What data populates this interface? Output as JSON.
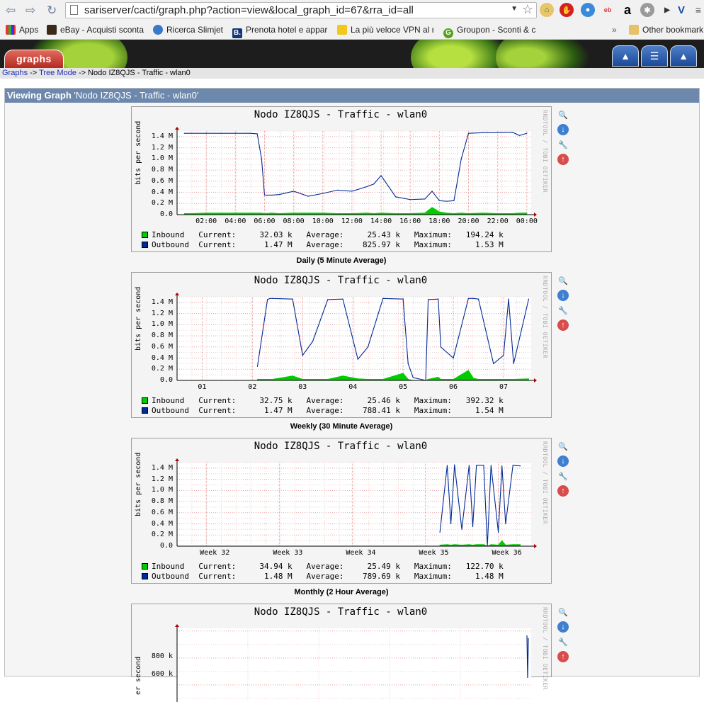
{
  "browser": {
    "url_host": "sariserver",
    "url_path": "/cacti/graph.php?action=view&local_graph_id=67&rra_id=all",
    "bookmarks": [
      "Apps",
      "eBay - Acquisti sconta",
      "Ricerca Slimjet",
      "Prenota hotel e appar",
      "La più veloce VPN al n",
      "Groupon - Sconti & c"
    ],
    "other_bookmarks": "Other bookmark"
  },
  "header": {
    "tab_label": "graphs"
  },
  "breadcrumb": {
    "graphs": "Graphs",
    "sep1": " -> ",
    "tree_mode": "Tree Mode",
    "sep2": " -> ",
    "current": "Nodo IZ8QJS - Traffic - wlan0"
  },
  "view": {
    "label": "Viewing Graph",
    "name": "'Nodo IZ8QJS - Traffic - wlan0'"
  },
  "colors": {
    "inbound": "#00cc00",
    "outbound": "#002a97",
    "grid": "#e8a0a0"
  },
  "graphs": [
    {
      "title": "Nodo IZ8QJS - Traffic - wlan0",
      "vlabel": "bits per second",
      "rrdtool": "RRDTOOL / TOBI OETIKER",
      "caption": "Daily (5 Minute Average)",
      "yticks": [
        "1.4 M",
        "1.2 M",
        "1.0 M",
        "0.8 M",
        "0.6 M",
        "0.4 M",
        "0.2 M",
        "0.0"
      ],
      "xticks": [
        "02:00",
        "04:00",
        "06:00",
        "08:00",
        "10:00",
        "12:00",
        "14:00",
        "16:00",
        "18:00",
        "20:00",
        "22:00",
        "00:00"
      ],
      "legend": [
        {
          "name": "Inbound ",
          "text": "  Current:     32.03 k   Average:     25.43 k   Maximum:   194.24 k"
        },
        {
          "name": "Outbound",
          "text": "  Current:      1.47 M   Average:    825.97 k   Maximum:     1.53 M"
        }
      ]
    },
    {
      "title": "Nodo IZ8QJS - Traffic - wlan0",
      "vlabel": "bits per second",
      "rrdtool": "RRDTOOL / TOBI OETIKER",
      "caption": "Weekly (30 Minute Average)",
      "yticks": [
        "1.4 M",
        "1.2 M",
        "1.0 M",
        "0.8 M",
        "0.6 M",
        "0.4 M",
        "0.2 M",
        "0.0"
      ],
      "xticks": [
        "01",
        "02",
        "03",
        "04",
        "05",
        "06",
        "07"
      ],
      "legend": [
        {
          "name": "Inbound ",
          "text": "  Current:     32.75 k   Average:     25.46 k   Maximum:   392.32 k"
        },
        {
          "name": "Outbound",
          "text": "  Current:      1.47 M   Average:    788.41 k   Maximum:     1.54 M"
        }
      ]
    },
    {
      "title": "Nodo IZ8QJS - Traffic - wlan0",
      "vlabel": "bits per second",
      "rrdtool": "RRDTOOL / TOBI OETIKER",
      "caption": "Monthly (2 Hour Average)",
      "yticks": [
        "1.4 M",
        "1.2 M",
        "1.0 M",
        "0.8 M",
        "0.6 M",
        "0.4 M",
        "0.2 M",
        "0.0"
      ],
      "xticks": [
        "Week 32",
        "Week 33",
        "Week 34",
        "Week 35",
        "Week 36"
      ],
      "legend": [
        {
          "name": "Inbound ",
          "text": "  Current:     34.94 k   Average:     25.49 k   Maximum:   122.70 k"
        },
        {
          "name": "Outbound",
          "text": "  Current:      1.48 M   Average:    789.69 k   Maximum:     1.48 M"
        }
      ]
    },
    {
      "title": "Nodo IZ8QJS - Traffic - wlan0",
      "vlabel": "er second",
      "rrdtool": "RRDTOOL / TOBI OETIKER",
      "caption": "",
      "yticks": [
        "800 k",
        "600 k"
      ],
      "xticks": [],
      "legend": []
    }
  ],
  "chart_data": [
    {
      "type": "line",
      "title": "Nodo IZ8QJS - Traffic - wlan0",
      "ylabel": "bits per second",
      "ylim": [
        0,
        1.5
      ],
      "x_unit": "hour of day",
      "x": [
        0.5,
        1,
        2,
        3,
        4,
        5,
        5.5,
        5.8,
        6,
        6.5,
        7,
        8,
        9,
        10,
        11,
        12,
        13,
        13.5,
        14,
        15,
        16,
        17,
        17.5,
        18,
        18.5,
        19,
        19.5,
        20,
        21,
        22,
        23,
        23.5,
        24
      ],
      "series": [
        {
          "name": "Outbound",
          "values": [
            1.46,
            1.46,
            1.46,
            1.46,
            1.46,
            1.46,
            1.45,
            1.0,
            0.35,
            0.35,
            0.36,
            0.42,
            0.33,
            0.38,
            0.44,
            0.42,
            0.5,
            0.55,
            0.7,
            0.32,
            0.27,
            0.28,
            0.42,
            0.25,
            0.24,
            0.25,
            1.0,
            1.46,
            1.47,
            1.47,
            1.48,
            1.42,
            1.46
          ]
        },
        {
          "name": "Inbound",
          "values": [
            0.02,
            0.02,
            0.03,
            0.03,
            0.03,
            0.03,
            0.03,
            0.03,
            0.02,
            0.03,
            0.02,
            0.03,
            0.03,
            0.03,
            0.02,
            0.02,
            0.03,
            0.02,
            0.03,
            0.02,
            0.02,
            0.03,
            0.13,
            0.05,
            0.03,
            0.02,
            0.03,
            0.02,
            0.03,
            0.02,
            0.02,
            0.03,
            0.03
          ]
        }
      ]
    },
    {
      "type": "line",
      "title": "Nodo IZ8QJS - Traffic - wlan0",
      "ylabel": "bits per second",
      "ylim": [
        0,
        1.5
      ],
      "x_unit": "day of month",
      "x": [
        2.1,
        2.3,
        2.35,
        2.4,
        2.8,
        3.0,
        3.2,
        3.5,
        3.8,
        4.1,
        4.3,
        4.6,
        5.0,
        5.1,
        5.2,
        5.45,
        5.5,
        5.7,
        5.75,
        6.0,
        6.3,
        6.4,
        6.5,
        6.8,
        7.0,
        7.1,
        7.2,
        7.5
      ],
      "series": [
        {
          "name": "Outbound",
          "values": [
            0.25,
            1.45,
            1.47,
            1.47,
            1.46,
            0.45,
            0.7,
            1.45,
            1.46,
            0.38,
            0.6,
            1.47,
            1.46,
            0.3,
            0.05,
            0.0,
            1.45,
            1.46,
            0.6,
            0.4,
            1.47,
            1.47,
            1.46,
            0.3,
            0.45,
            1.46,
            0.3,
            1.46
          ]
        },
        {
          "name": "Inbound",
          "values": [
            0.02,
            0.02,
            0.02,
            0.02,
            0.08,
            0.02,
            0.02,
            0.02,
            0.08,
            0.03,
            0.02,
            0.02,
            0.13,
            0.02,
            0.0,
            0.0,
            0.02,
            0.06,
            0.02,
            0.02,
            0.18,
            0.04,
            0.02,
            0.02,
            0.02,
            0.02,
            0.02,
            0.03
          ]
        }
      ]
    },
    {
      "type": "line",
      "title": "Nodo IZ8QJS - Traffic - wlan0",
      "ylabel": "bits per second",
      "ylim": [
        0,
        1.5
      ],
      "x_unit": "ISO week",
      "x": [
        35.2,
        35.3,
        35.35,
        35.4,
        35.5,
        35.6,
        35.65,
        35.7,
        35.8,
        35.85,
        35.9,
        36.0,
        36.05,
        36.1,
        36.2,
        36.3
      ],
      "series": [
        {
          "name": "Outbound",
          "values": [
            0.25,
            1.45,
            0.4,
            1.46,
            0.3,
            1.45,
            0.35,
            1.45,
            1.45,
            0.0,
            1.45,
            0.25,
            1.44,
            0.4,
            1.45,
            1.44
          ]
        },
        {
          "name": "Inbound",
          "values": [
            0.02,
            0.03,
            0.02,
            0.03,
            0.02,
            0.03,
            0.02,
            0.03,
            0.03,
            0.0,
            0.03,
            0.02,
            0.1,
            0.02,
            0.03,
            0.03
          ]
        }
      ]
    }
  ]
}
